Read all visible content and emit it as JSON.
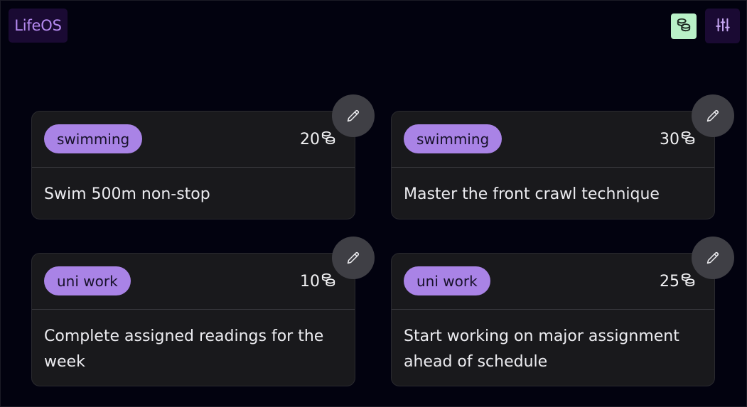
{
  "app": {
    "logo_text": "LifeOS",
    "coins_icon": "coins-icon",
    "settings_icon": "sliders-icon"
  },
  "colors": {
    "background": "#02020f",
    "card": "#19191c",
    "tag": "#a983e6",
    "logo_text": "#b58af0",
    "coins_button": "#b9f1c8",
    "edit_button": "#3f3f45"
  },
  "goals": [
    {
      "tag": "swimming",
      "points": "20",
      "title": "Swim 500m non-stop"
    },
    {
      "tag": "swimming",
      "points": "30",
      "title": "Master the front crawl technique"
    },
    {
      "tag": "uni work",
      "points": "10",
      "title": "Complete assigned readings for the week"
    },
    {
      "tag": "uni work",
      "points": "25",
      "title": "Start working on major assignment ahead of schedule"
    }
  ]
}
